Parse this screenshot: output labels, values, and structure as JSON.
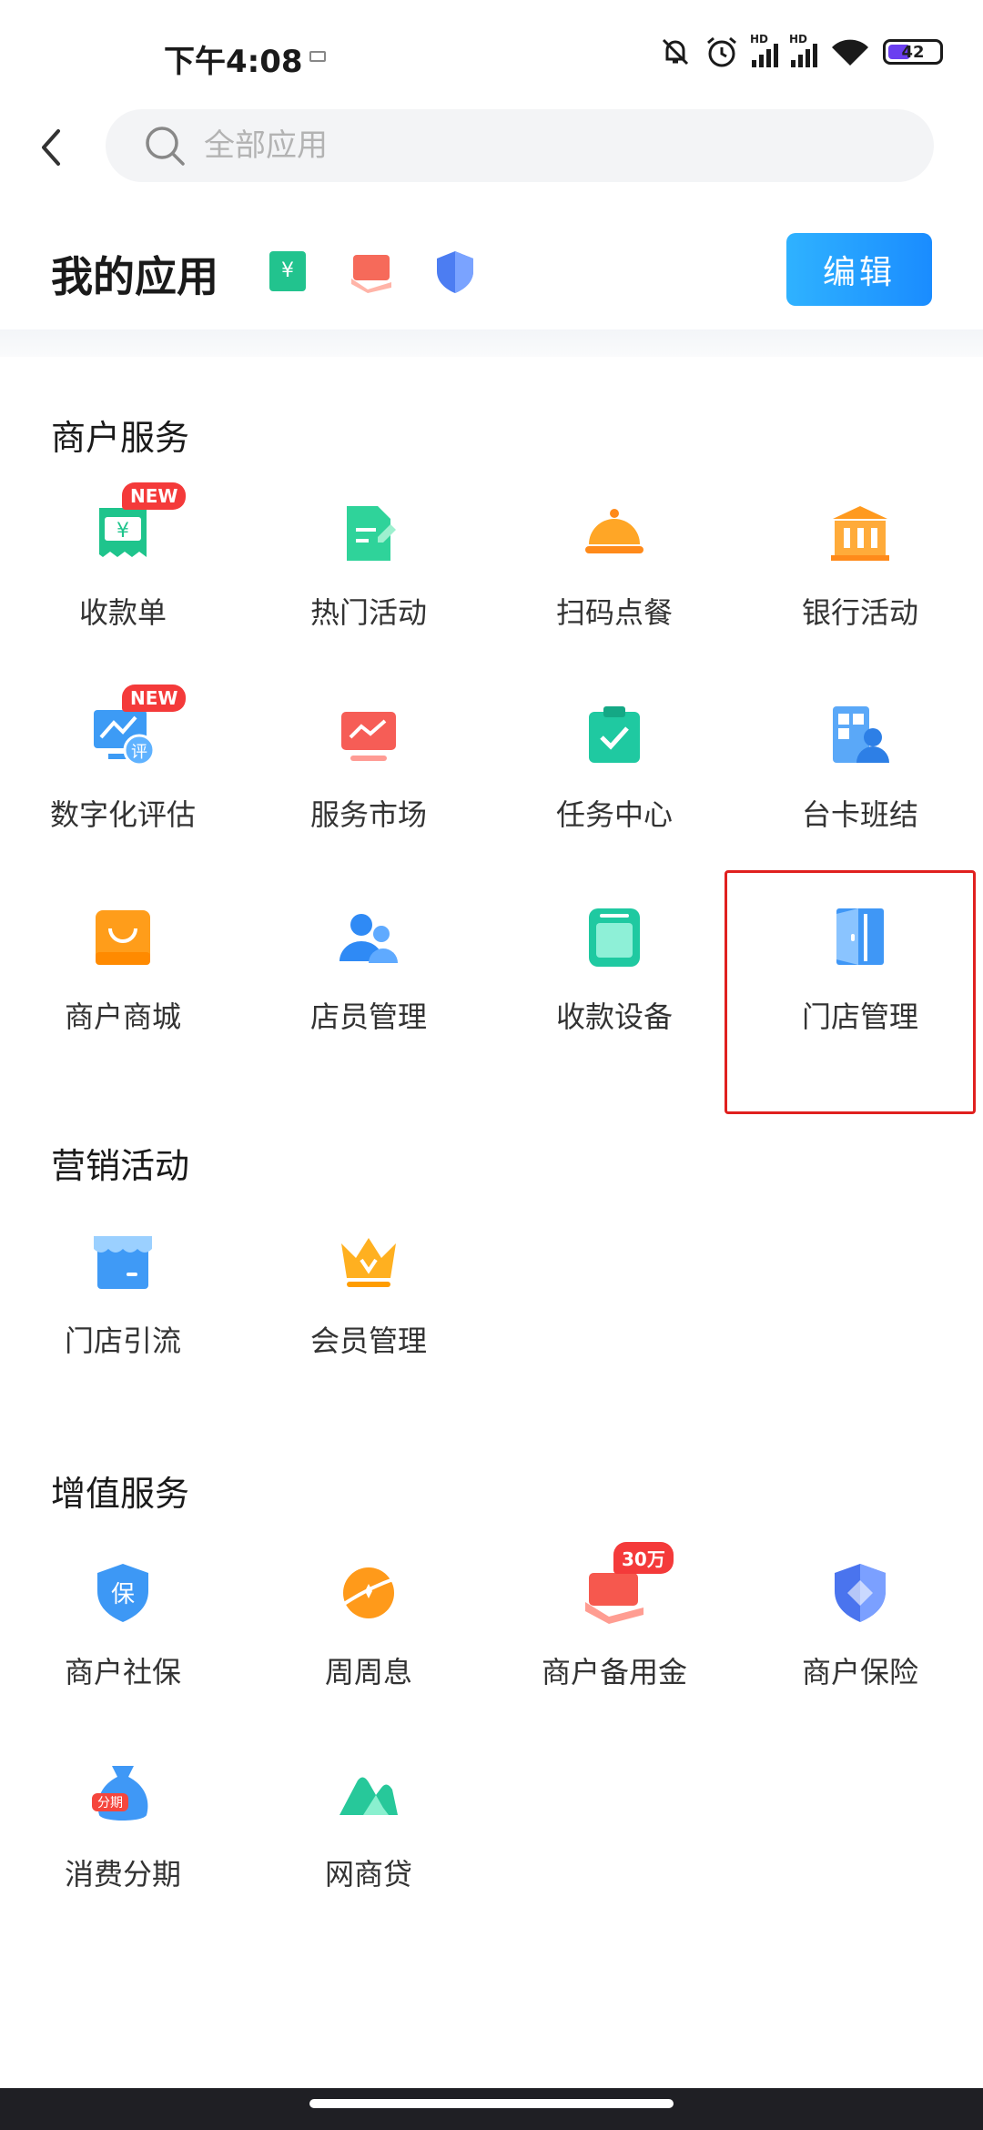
{
  "status_bar": {
    "time": "下午4:08",
    "battery": "42",
    "signal_label_1": "HD",
    "signal_label_2": "HD"
  },
  "search": {
    "placeholder": "全部应用"
  },
  "my_apps": {
    "title": "我的应用",
    "edit_label": "编辑",
    "pinned_icons": [
      "receipt-icon",
      "red-card-icon",
      "shield-icon"
    ]
  },
  "sections": [
    {
      "title": "商户服务",
      "items": [
        {
          "label": "收款单",
          "icon": "receipt-icon",
          "badge": "NEW"
        },
        {
          "label": "热门活动",
          "icon": "document-pen-icon"
        },
        {
          "label": "扫码点餐",
          "icon": "food-cloche-icon"
        },
        {
          "label": "银行活动",
          "icon": "bank-icon"
        },
        {
          "label": "数字化评估",
          "icon": "monitor-evaluate-icon",
          "badge": "NEW"
        },
        {
          "label": "服务市场",
          "icon": "market-monitor-icon"
        },
        {
          "label": "任务中心",
          "icon": "clipboard-check-icon"
        },
        {
          "label": "台卡班结",
          "icon": "qr-person-icon"
        },
        {
          "label": "商户商城",
          "icon": "shopping-bag-icon"
        },
        {
          "label": "店员管理",
          "icon": "staff-icon"
        },
        {
          "label": "收款设备",
          "icon": "device-icon"
        },
        {
          "label": "门店管理",
          "icon": "store-door-icon"
        }
      ]
    },
    {
      "title": "营销活动",
      "items": [
        {
          "label": "门店引流",
          "icon": "storefront-icon"
        },
        {
          "label": "会员管理",
          "icon": "crown-icon"
        }
      ]
    },
    {
      "title": "增值服务",
      "items": [
        {
          "label": "商户社保",
          "icon": "insurance-shield-icon",
          "glyph": "保"
        },
        {
          "label": "周周息",
          "icon": "orange-planet-icon"
        },
        {
          "label": "商户备用金",
          "icon": "red-card-icon",
          "badge": "30万"
        },
        {
          "label": "商户保险",
          "icon": "shield-icon"
        },
        {
          "label": "消费分期",
          "icon": "money-bag-icon",
          "glyph": "分期"
        },
        {
          "label": "网商贷",
          "icon": "green-mountain-icon"
        }
      ]
    }
  ],
  "colors": {
    "accent": "#1a8cff",
    "badge": "#f43a3a",
    "highlight": "#e0201f"
  }
}
